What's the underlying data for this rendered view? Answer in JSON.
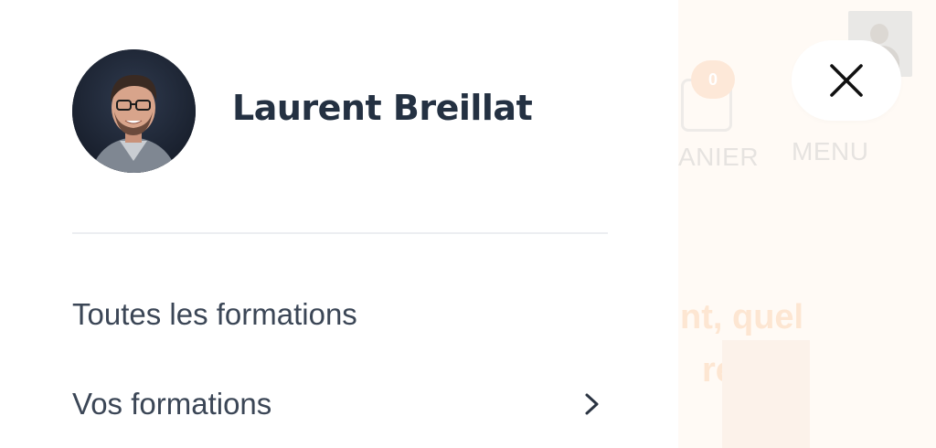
{
  "background": {
    "cart_count": "0",
    "cart_label": "ANIER",
    "menu_label": "MENU",
    "heading_line1": "nt, quel",
    "heading_line2": "reau :"
  },
  "close_button": {
    "icon": "close-icon"
  },
  "drawer": {
    "user": {
      "name": "Laurent Breillat",
      "avatar_icon": "avatar"
    },
    "menu": [
      {
        "label": "Toutes les formations",
        "has_submenu": false
      },
      {
        "label": "Vos formations",
        "has_submenu": true,
        "icon": "chevron-right-icon"
      }
    ]
  },
  "colors": {
    "text_dark": "#243142",
    "text_menu": "#3b4656",
    "overlay_bg": "#fffaf5",
    "accent_faded": "#fde6d2"
  }
}
